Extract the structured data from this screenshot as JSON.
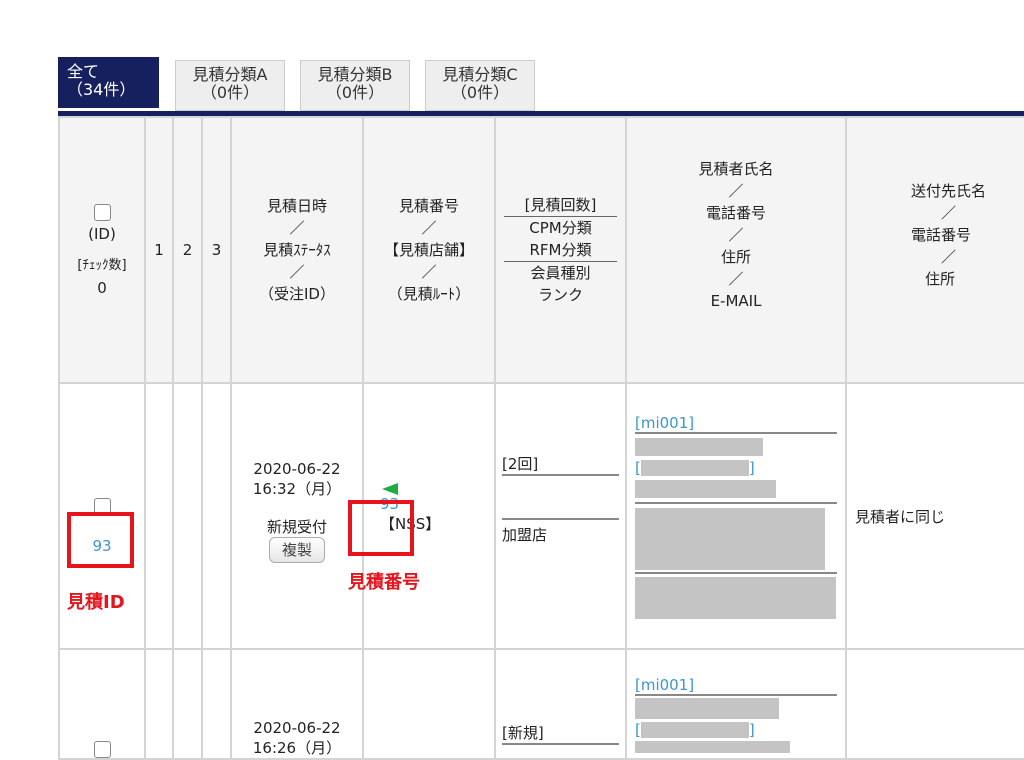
{
  "tabs": [
    {
      "label": "全て",
      "count": "（34件）",
      "selected": true
    },
    {
      "label": "見積分類A",
      "count": "（0件）"
    },
    {
      "label": "見積分類B",
      "count": "（0件）"
    },
    {
      "label": "見積分類C",
      "count": "（0件）"
    }
  ],
  "header": {
    "id": "(ID)",
    "check_count_label": "[ﾁｪｯｸ数]",
    "check_count": "0",
    "c1": "1",
    "c2": "2",
    "c3": "3",
    "date": [
      "見積日時",
      "／",
      "見積ｽﾃｰﾀｽ",
      "／",
      "（受注ID）"
    ],
    "number": [
      "見積番号",
      "／",
      "【見積店舗】",
      "／",
      "（見積ﾙｰﾄ）"
    ],
    "count": [
      "[見積回数]",
      "CPM分類",
      "RFM分類",
      "会員種別",
      "ランク"
    ],
    "customer": [
      "見積者氏名",
      "／",
      "電話番号",
      "／",
      "住所",
      "／",
      "E-MAIL"
    ],
    "ship": [
      "送付先氏名",
      "／",
      "電話番号",
      "／",
      "住所"
    ]
  },
  "rows": [
    {
      "id": "93",
      "date": "2020-06-22",
      "time": "16:32（月）",
      "status": "新規受付",
      "copy": "複製",
      "number": "93",
      "store": "【NSS】",
      "count": "[2回]",
      "member": "加盟店",
      "code": "[mi001]",
      "bracket_open": "[",
      "bracket_close": "]",
      "ship": "見積者に同じ"
    },
    {
      "date": "2020-06-22",
      "time": "16:26（月）",
      "count": "[新規]",
      "code": "[mi001]",
      "bracket_open": "[",
      "bracket_close": "]"
    }
  ],
  "annotations": {
    "id_label": "見積ID",
    "number_label": "見積番号"
  },
  "colors": {
    "navy": "#16205e",
    "link": "#3a96d0",
    "annotation": "#e8141c",
    "flag": "#22aa44"
  }
}
